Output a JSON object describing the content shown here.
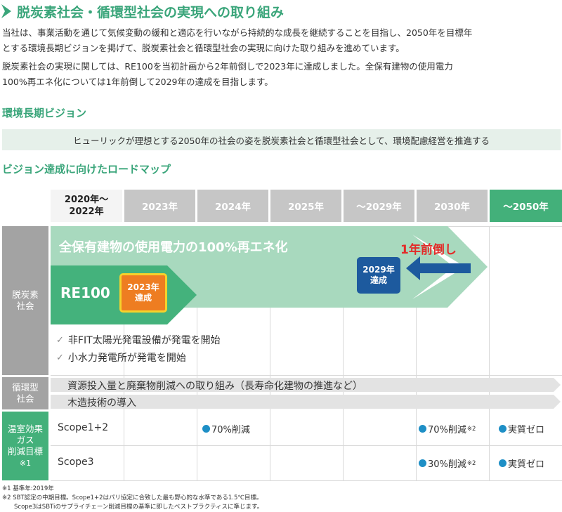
{
  "title": "脱炭素社会・循環型社会の実現への取り組み",
  "intro": {
    "line1": "当社は、事業活動を通じて気候変動の緩和と適応を行いながら持続的な成長を継続することを目指し、2050年を目標年",
    "line2": "とする環境長期ビジョンを掲げて、脱炭素社会と循環型社会の実現に向けた取り組みを進めています。",
    "line3": "脱炭素社会の実現に関しては、RE100を当初計画から2年前倒しで2023年に達成しました。全保有建物の使用電力",
    "line4": "100%再エネ化については1年前倒して2029年の達成を目指します。"
  },
  "vision": {
    "heading": "環境長期ビジョン",
    "text": "ヒューリックが理想とする2050年の社会の姿を脱炭素社会と循環型社会として、環境配慮経営を推進する"
  },
  "roadmap": {
    "heading": "ビジョン達成に向けたロードマップ",
    "columns": [
      "2020年～\n2022年",
      "2023年",
      "2024年",
      "2025年",
      "～2029年",
      "2030年",
      "～2050年"
    ],
    "col0_line1": "2020年～",
    "col0_line2": "2022年",
    "rows": {
      "decarb": {
        "line1": "脱炭素",
        "line2": "社会"
      },
      "circular": {
        "line1": "循環型",
        "line2": "社会"
      },
      "ghg": {
        "line1": "温室効果",
        "line2": "ガス",
        "line3": "削減目標",
        "line4": "※1"
      }
    },
    "decarb": {
      "big_arrow": "全保有建物の使用電力の100%再エネ化",
      "ahead": "1年前倒し",
      "badge_2029_l1": "2029年",
      "badge_2029_l2": "達成",
      "re100": "RE100",
      "badge_2023_l1": "2023年",
      "badge_2023_l2": "達成",
      "checks": [
        "非FIT太陽光発電設備が発電を開始",
        "小水力発電所が発電を開始"
      ],
      "check_mark": "✓"
    },
    "circular": {
      "band1": "資源投入量と廃棄物削減への取り組み（長寿命化建物の推進など）",
      "band2": "木造技術の導入"
    },
    "ghg": {
      "scope12": {
        "label": "Scope1+2",
        "y2024": "70%削減",
        "y2030": "70%削減",
        "y2030_note": "※2",
        "y2050": "実質ゼロ"
      },
      "scope3": {
        "label": "Scope3",
        "y2030": "30%削減",
        "y2030_note": "※2",
        "y2050": "実質ゼロ"
      }
    }
  },
  "notes": {
    "n1": "※1 基準年:2019年",
    "n2": "※2 SBT認定の中期目標。Scope1+2はパリ協定に合致した最も野心的な水準である1.5℃目標。",
    "n3": "Scope3はSBTiのサプライチェーン削減目標の基準に即したベストプラクティスに準じます。"
  },
  "colors": {
    "green": "#3aa57a",
    "header_gray": "#c6c6c6",
    "header_green": "#43b07a",
    "label_gray": "#a3a3a3",
    "label_green": "#43b07a",
    "light_arrow": "#a8d9be",
    "dark_arrow": "#44b27c",
    "orange": "#ee7d21",
    "navy": "#1d5a9e",
    "red": "#e32a28",
    "dot_blue": "#1e8fc6"
  }
}
